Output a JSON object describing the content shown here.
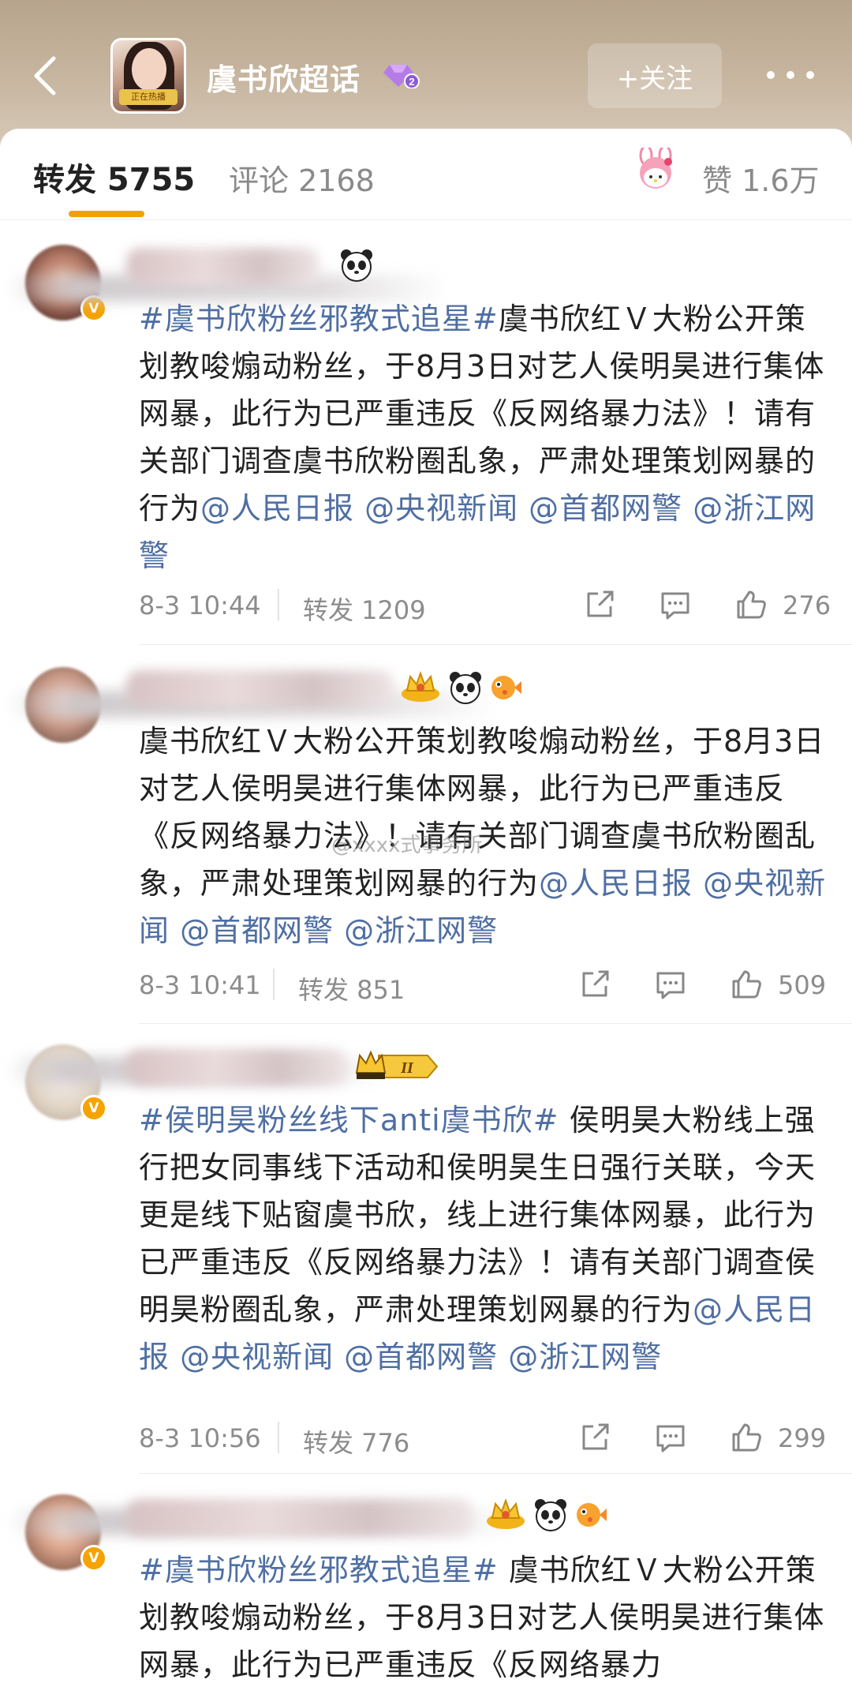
{
  "header": {
    "title": "虞书欣超话",
    "level_badge": "2",
    "follow_label": "+关注",
    "avatar_tag": "正在热播"
  },
  "tabs": {
    "repost_label": "转发 5755",
    "comments_label": "评论 2168",
    "likes_label": "赞 1.6万"
  },
  "colors": {
    "accent": "#f4a000",
    "link": "#4f6fa3",
    "header_bg": "#c2b09a"
  },
  "posts": [
    {
      "text_parts": [
        {
          "t": "#虞书欣粉丝邪教式追星#",
          "hl": true
        },
        {
          "t": "虞书欣红Ｖ大粉公开策划教唆煽动粉丝，于8月3日对艺人侯明昊进行集体网暴，此行为已严重违反《反网络暴力法》！请有关部门调查虞书欣粉圈乱象，严肃处理策划网暴的行为",
          "hl": false
        },
        {
          "t": "@人民日报 @央视新闻 @首都网警 @浙江网警",
          "hl": true
        }
      ],
      "time": "8-3 10:44",
      "repost": "转发 1209",
      "likes": "276",
      "verified": true,
      "badges": [
        "panda-icon"
      ]
    },
    {
      "text_parts": [
        {
          "t": "虞书欣红Ｖ大粉公开策划教唆煽动粉丝，于8月3日对艺人侯明昊进行集体网暴，此行为已严重违反《反网络暴力法》！请有关部门调查虞书欣粉圈乱象，严肃处理策划网暴的行为",
          "hl": false
        },
        {
          "t": "@人民日报 @央视新闻 @首都网警 @浙江网警",
          "hl": true
        }
      ],
      "watermark": "@xxxx式事务所",
      "time": "8-3 10:41",
      "repost": "转发 851",
      "likes": "509",
      "verified": false,
      "badges": [
        "crown-icon",
        "panda-icon",
        "pufferfish-icon"
      ]
    },
    {
      "text_parts": [
        {
          "t": "#侯明昊粉丝线下anti虞书欣#",
          "hl": true
        },
        {
          "t": " 侯明昊大粉线上强行把女同事线下活动和侯明昊生日强行关联，今天更是线下贴窗虞书欣，线上进行集体网暴，此行为已严重违反《反网络暴力法》！请有关部门调查侯明昊粉圈乱象，严肃处理策划网暴的行为",
          "hl": false
        },
        {
          "t": "@人民日报 @央视新闻 @首都网警 @浙江网警",
          "hl": true
        }
      ],
      "time": "8-3 10:56",
      "repost": "转发 776",
      "likes": "299",
      "verified": true,
      "badges": [
        "member-level-icon"
      ],
      "member_level": "II"
    },
    {
      "text_parts": [
        {
          "t": "#虞书欣粉丝邪教式追星#",
          "hl": true
        },
        {
          "t": " 虞书欣红Ｖ大粉公开策划教唆煽动粉丝，于8月3日对艺人侯明昊进行集体网暴，此行为已严重违反《反网络暴力",
          "hl": false
        }
      ],
      "verified": true,
      "badges": [
        "crown-icon",
        "panda-icon",
        "pufferfish-icon"
      ]
    }
  ]
}
